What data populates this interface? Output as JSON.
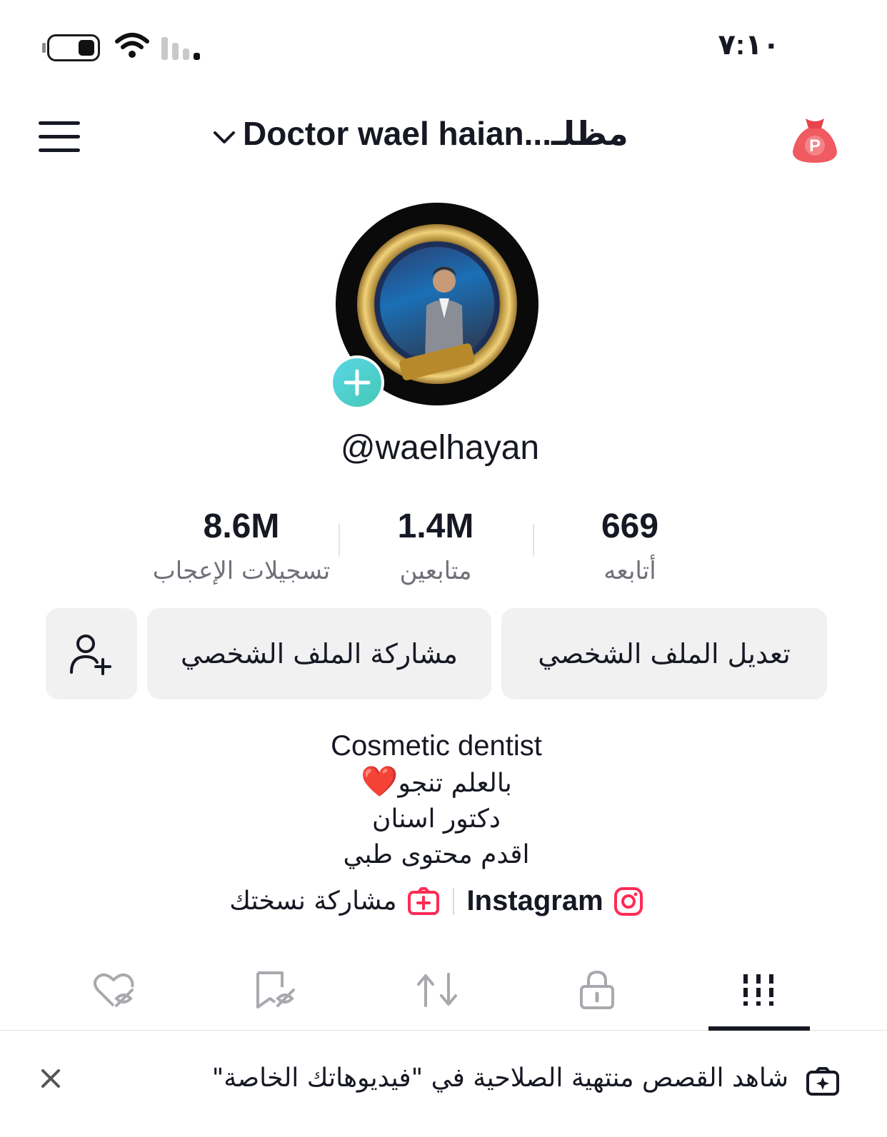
{
  "status_bar": {
    "time": "٧:١٠"
  },
  "header": {
    "title": "Doctor  wael  haian...مظلـ"
  },
  "profile": {
    "username": "@waelhayan"
  },
  "stats": [
    {
      "value": "8.6M",
      "label": "تسجيلات الإعجاب"
    },
    {
      "value": "1.4M",
      "label": "متابعين"
    },
    {
      "value": "669",
      "label": "أتابعه"
    }
  ],
  "actions": {
    "edit_profile": "تعديل الملف الشخصي",
    "share_profile": "مشاركة الملف الشخصي"
  },
  "bio": {
    "line1": "Cosmetic dentist",
    "line2": "بالعلم تنجو",
    "line2_emoji": "❤️",
    "line3": "دكتور اسنان",
    "line4": "اقدم محتوى طبي"
  },
  "links": {
    "instagram": "Instagram",
    "share_copy": "مشاركة نسختك"
  },
  "banner": {
    "text": "شاهد القصص منتهية الصلاحية في \"فيديوهاتك الخاصة\""
  },
  "colors": {
    "accent_pink": "#fe2c55",
    "teal": "#4fd1d9",
    "text": "#161823",
    "muted": "#6f7078",
    "button_bg": "#f1f1f2"
  }
}
